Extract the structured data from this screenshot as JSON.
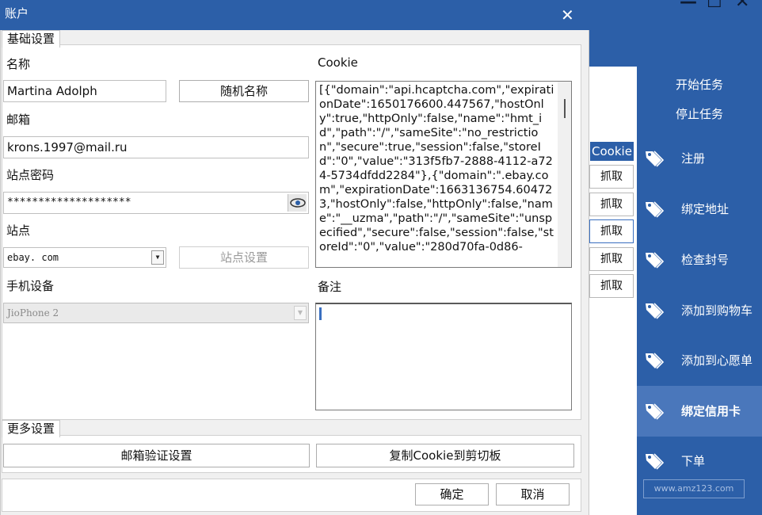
{
  "window": {
    "title": "账户"
  },
  "basic": {
    "legend": "基础设置",
    "name_label": "名称",
    "name_value": "Martina Adolph",
    "random_name_button": "随机名称",
    "email_label": "邮箱",
    "email_value": "krons.1997@mail.ru",
    "password_label": "站点密码",
    "password_value": "********************",
    "site_label": "站点",
    "site_value": "ebay. com",
    "site_settings_button": "站点设置",
    "device_label": "手机设备",
    "device_value": "JioPhone 2",
    "cookie_label": "Cookie",
    "cookie_value": "[{\"domain\":\"api.hcaptcha.com\",\"expirationDate\":1650176600.447567,\"hostOnly\":true,\"httpOnly\":false,\"name\":\"hmt_id\",\"path\":\"/\",\"sameSite\":\"no_restriction\",\"secure\":true,\"session\":false,\"storeId\":\"0\",\"value\":\"313f5fb7-2888-4112-a724-5734dfdd2284\"},{\"domain\":\".ebay.com\",\"expirationDate\":1663136754.604723,\"hostOnly\":false,\"httpOnly\":false,\"name\":\"__uzma\",\"path\":\"/\",\"sameSite\":\"unspecified\",\"secure\":false,\"session\":false,\"storeId\":\"0\",\"value\":\"280d70fa-0d86-",
    "notes_label": "备注",
    "notes_value": ""
  },
  "more": {
    "legend": "更多设置",
    "email_verify_button": "邮箱验证设置",
    "copy_cookie_button": "复制Cookie到剪切板"
  },
  "footer": {
    "ok_button": "确定",
    "cancel_button": "取消"
  },
  "background_app": {
    "window_controls": [
      "—",
      "☐",
      "✕"
    ],
    "start_task": "开始任务",
    "stop_task": "停止任务",
    "cookie_tab": "Cookie",
    "grab_buttons": [
      "抓取",
      "抓取",
      "抓取",
      "抓取",
      "抓取"
    ],
    "menu": [
      {
        "label": "注册"
      },
      {
        "label": "绑定地址"
      },
      {
        "label": "检查封号"
      },
      {
        "label": "添加到购物车"
      },
      {
        "label": "添加到心愿单"
      },
      {
        "label": "绑定信用卡",
        "active": true
      },
      {
        "label": "下单"
      }
    ],
    "watermark": "www.amz123.com"
  },
  "colors": {
    "accent": "#2c5fa8",
    "active_item": "#4a77bb"
  }
}
